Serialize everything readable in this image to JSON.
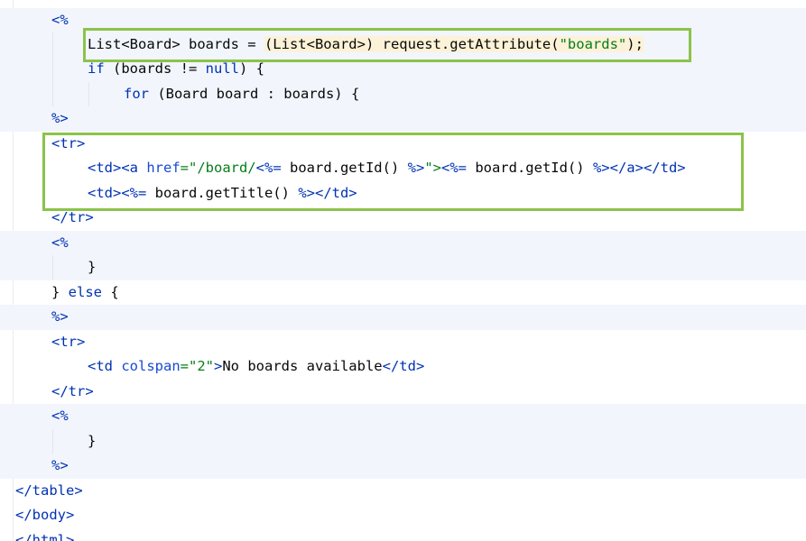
{
  "editor": {
    "lines": [
      {
        "id": "l1",
        "parts": [
          {
            "t": "<%",
            "c": "jsp"
          }
        ]
      },
      {
        "id": "l2",
        "parts": [
          {
            "t": "List<Board> boards = ",
            "c": "id"
          },
          {
            "t": "(List<Board>) request.getAttribute(",
            "c": "id",
            "hl": true
          },
          {
            "t": "\"boards\"",
            "c": "str",
            "hl": true
          },
          {
            "t": ");",
            "c": "id",
            "hl": true
          }
        ]
      },
      {
        "id": "l3",
        "parts": [
          {
            "t": "if",
            "c": "kw"
          },
          {
            "t": " (boards != ",
            "c": "id"
          },
          {
            "t": "null",
            "c": "kw"
          },
          {
            "t": ") {",
            "c": "id"
          }
        ]
      },
      {
        "id": "l4",
        "parts": [
          {
            "t": "for",
            "c": "kw"
          },
          {
            "t": " (Board board : boards) {",
            "c": "id"
          }
        ]
      },
      {
        "id": "l5",
        "parts": [
          {
            "t": "%>",
            "c": "jsp"
          }
        ]
      },
      {
        "id": "l6",
        "parts": [
          {
            "t": "<tr>",
            "c": "tag"
          }
        ]
      },
      {
        "id": "l7",
        "parts": [
          {
            "t": "<td><a ",
            "c": "tag"
          },
          {
            "t": "href",
            "c": "attr"
          },
          {
            "t": "=\"/board/",
            "c": "str"
          },
          {
            "t": "<%=",
            "c": "jsp"
          },
          {
            "t": " board.getId() ",
            "c": "id"
          },
          {
            "t": "%>",
            "c": "jsp"
          },
          {
            "t": "\">",
            "c": "str"
          },
          {
            "t": "<%=",
            "c": "jsp"
          },
          {
            "t": " board.getId() ",
            "c": "id"
          },
          {
            "t": "%>",
            "c": "jsp"
          },
          {
            "t": "</a></td>",
            "c": "tag"
          }
        ]
      },
      {
        "id": "l8",
        "parts": [
          {
            "t": "<td>",
            "c": "tag"
          },
          {
            "t": "<%=",
            "c": "jsp"
          },
          {
            "t": " board.getTitle() ",
            "c": "id"
          },
          {
            "t": "%>",
            "c": "jsp"
          },
          {
            "t": "</td>",
            "c": "tag"
          }
        ]
      },
      {
        "id": "l9",
        "parts": [
          {
            "t": "</tr>",
            "c": "tag"
          }
        ]
      },
      {
        "id": "l10",
        "parts": [
          {
            "t": "<%",
            "c": "jsp"
          }
        ]
      },
      {
        "id": "l11",
        "parts": [
          {
            "t": "}",
            "c": "id"
          }
        ]
      },
      {
        "id": "l12",
        "parts": [
          {
            "t": "} ",
            "c": "id"
          },
          {
            "t": "else",
            "c": "kw"
          },
          {
            "t": " {",
            "c": "id"
          }
        ]
      },
      {
        "id": "l13",
        "parts": [
          {
            "t": "%>",
            "c": "jsp"
          }
        ]
      },
      {
        "id": "l14",
        "parts": [
          {
            "t": "<tr>",
            "c": "tag"
          }
        ]
      },
      {
        "id": "l15",
        "parts": [
          {
            "t": "<td ",
            "c": "tag"
          },
          {
            "t": "colspan",
            "c": "attr"
          },
          {
            "t": "=\"2\"",
            "c": "str"
          },
          {
            "t": ">",
            "c": "tag"
          },
          {
            "t": "No boards available",
            "c": "id"
          },
          {
            "t": "</td>",
            "c": "tag"
          }
        ]
      },
      {
        "id": "l16",
        "parts": [
          {
            "t": "</tr>",
            "c": "tag"
          }
        ]
      },
      {
        "id": "l17",
        "parts": [
          {
            "t": "<%",
            "c": "jsp"
          }
        ]
      },
      {
        "id": "l18",
        "parts": [
          {
            "t": "}",
            "c": "id"
          }
        ]
      },
      {
        "id": "l19",
        "parts": [
          {
            "t": "%>",
            "c": "jsp"
          }
        ]
      },
      {
        "id": "l20",
        "parts": [
          {
            "t": "</table>",
            "c": "tag"
          }
        ]
      },
      {
        "id": "l21",
        "parts": [
          {
            "t": "</body>",
            "c": "tag"
          }
        ]
      },
      {
        "id": "l22",
        "parts": [
          {
            "t": "</html>",
            "c": "tag"
          }
        ]
      }
    ]
  },
  "colors": {
    "tag": "#0033b3",
    "string": "#067d17",
    "keyword": "#0033b3",
    "highlight_box": "#8bc34a",
    "scriptlet_background": "#f2f5fc"
  }
}
